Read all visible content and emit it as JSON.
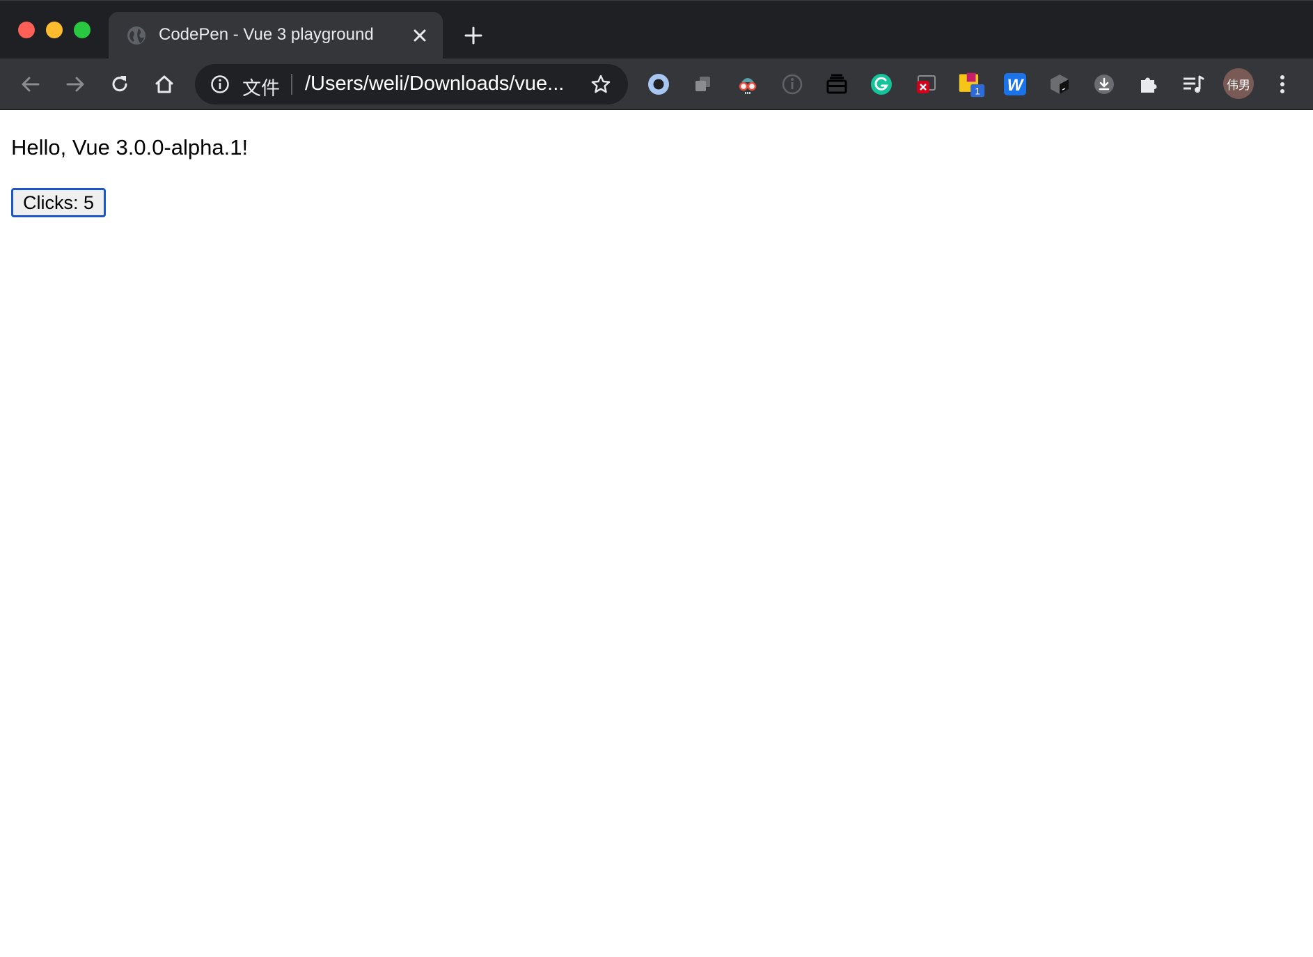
{
  "browser": {
    "tab": {
      "title": "CodePen - Vue 3 playground"
    },
    "omnibox": {
      "scheme_label": "文件",
      "url": "/Users/weli/Downloads/vue..."
    },
    "extensions": {
      "badge_count": "1",
      "wps_letter": "W"
    },
    "avatar_text": "伟男",
    "colors": {
      "tab_strip": "#1f2023",
      "toolbar": "#35363a",
      "omnibox": "#202124",
      "button_focus": "#1c56c7"
    }
  },
  "page": {
    "greeting": "Hello, Vue 3.0.0-alpha.1!",
    "clicks_button": "Clicks: 5"
  }
}
